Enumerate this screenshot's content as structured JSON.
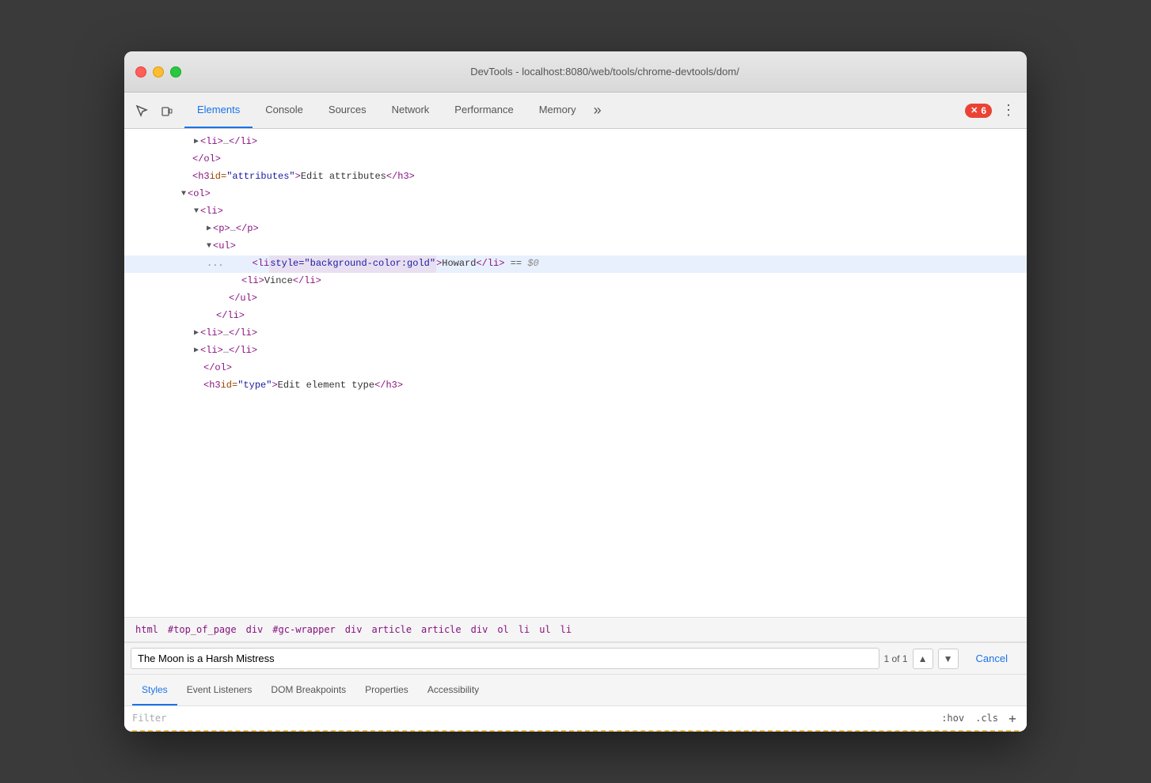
{
  "titlebar": {
    "title": "DevTools - localhost:8080/web/tools/chrome-devtools/dom/"
  },
  "tabs": [
    {
      "id": "elements",
      "label": "Elements",
      "active": true
    },
    {
      "id": "console",
      "label": "Console",
      "active": false
    },
    {
      "id": "sources",
      "label": "Sources",
      "active": false
    },
    {
      "id": "network",
      "label": "Network",
      "active": false
    },
    {
      "id": "performance",
      "label": "Performance",
      "active": false
    },
    {
      "id": "memory",
      "label": "Memory",
      "active": false
    }
  ],
  "toolbar": {
    "more_label": "»",
    "error_count": "6",
    "menu_label": "⋮"
  },
  "dom": {
    "lines": [
      {
        "indent": 5,
        "content": "▶<li>…</li>",
        "type": "collapsed"
      },
      {
        "indent": 4,
        "content": "</ol>",
        "type": "close"
      },
      {
        "indent": 4,
        "content": "<h3 id=\"attributes\">Edit attributes</h3>",
        "type": "tag"
      },
      {
        "indent": 4,
        "content": "▼<ol>",
        "type": "open"
      },
      {
        "indent": 5,
        "content": "▼<li>",
        "type": "open"
      },
      {
        "indent": 6,
        "content": "▶<p>…</p>",
        "type": "collapsed"
      },
      {
        "indent": 6,
        "content": "▼<ul>",
        "type": "open"
      },
      {
        "indent": 7,
        "content": "<li style=\"background-color:gold\">Howard</li> == $0",
        "type": "selected"
      },
      {
        "indent": 7,
        "content": "<li>Vince</li>",
        "type": "tag"
      },
      {
        "indent": 6,
        "content": "</ul>",
        "type": "close"
      },
      {
        "indent": 5,
        "content": "</li>",
        "type": "close"
      },
      {
        "indent": 5,
        "content": "▶<li>…</li>",
        "type": "collapsed"
      },
      {
        "indent": 5,
        "content": "▶<li>…</li>",
        "type": "collapsed"
      },
      {
        "indent": 4,
        "content": "</ol>",
        "type": "close"
      },
      {
        "indent": 4,
        "content": "<h3 id=\"type\">Edit element type</h3>",
        "type": "partial"
      }
    ]
  },
  "breadcrumb": {
    "items": [
      "html",
      "#top_of_page",
      "div",
      "#gc-wrapper",
      "div",
      "article",
      "article",
      "div",
      "ol",
      "li",
      "ul",
      "li"
    ]
  },
  "search": {
    "placeholder": "",
    "value": "The Moon is a Harsh Mistress",
    "count": "1 of 1",
    "cancel_label": "Cancel"
  },
  "bottom_tabs": [
    {
      "id": "styles",
      "label": "Styles",
      "active": true
    },
    {
      "id": "event-listeners",
      "label": "Event Listeners",
      "active": false
    },
    {
      "id": "dom-breakpoints",
      "label": "DOM Breakpoints",
      "active": false
    },
    {
      "id": "properties",
      "label": "Properties",
      "active": false
    },
    {
      "id": "accessibility",
      "label": "Accessibility",
      "active": false
    }
  ],
  "styles_filter": {
    "placeholder": "Filter",
    "hov_label": ":hov",
    "cls_label": ".cls",
    "add_label": "+"
  }
}
